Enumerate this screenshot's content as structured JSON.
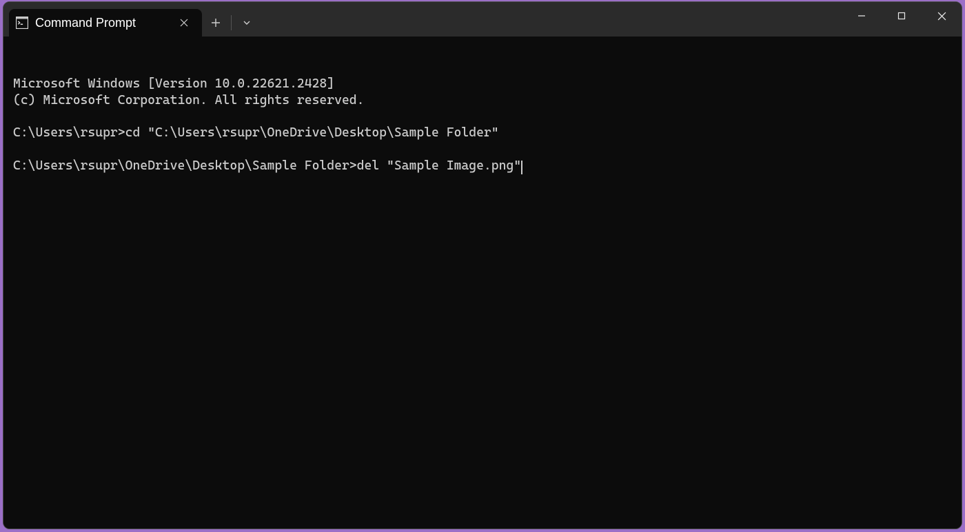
{
  "window": {
    "tab_title": "Command Prompt"
  },
  "terminal": {
    "lines": [
      "Microsoft Windows [Version 10.0.22621.2428]",
      "(c) Microsoft Corporation. All rights reserved.",
      "",
      "C:\\Users\\rsupr>cd \"C:\\Users\\rsupr\\OneDrive\\Desktop\\Sample Folder\"",
      ""
    ],
    "current_prompt": "C:\\Users\\rsupr\\OneDrive\\Desktop\\Sample Folder>",
    "current_input": "del \"Sample Image.png\""
  }
}
